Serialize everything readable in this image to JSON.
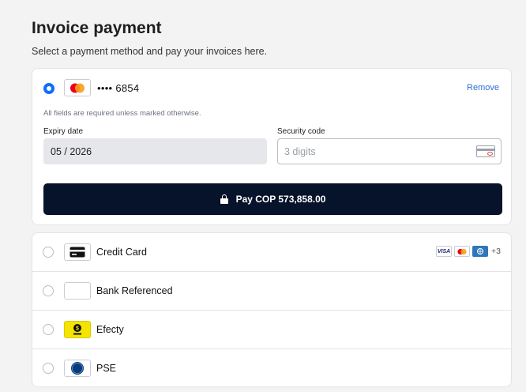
{
  "header": {
    "title": "Invoice payment",
    "subtitle": "Select a payment method and pay your invoices here."
  },
  "saved_card": {
    "brand_icon": "mastercard-icon",
    "masked_number": "•••• 6854",
    "remove_label": "Remove",
    "required_note": "All fields are required unless marked otherwise.",
    "expiry_label": "Expiry date",
    "expiry_value": "05 / 2026",
    "security_label": "Security code",
    "security_placeholder": "3 digits",
    "pay_label": "Pay COP 573,858.00",
    "selected": true
  },
  "methods": [
    {
      "label": "Credit Card",
      "icon": "credit-card-icon",
      "selected": false,
      "brands": [
        "VISA",
        "mastercard",
        "amex"
      ],
      "more": "+3"
    },
    {
      "label": "Bank Referenced",
      "icon": "bank-icon",
      "selected": false
    },
    {
      "label": "Efecty",
      "icon": "efecty-icon",
      "selected": false
    },
    {
      "label": "PSE",
      "icon": "pse-icon",
      "selected": false
    }
  ],
  "colors": {
    "accent": "#0d6efd",
    "pay_button": "#06132b",
    "link": "#2f6fd6",
    "mastercard_red": "#eb001b",
    "mastercard_orange": "#f79e1b",
    "efecty_yellow": "#f5e400",
    "pse_blue": "#0b3a78"
  }
}
